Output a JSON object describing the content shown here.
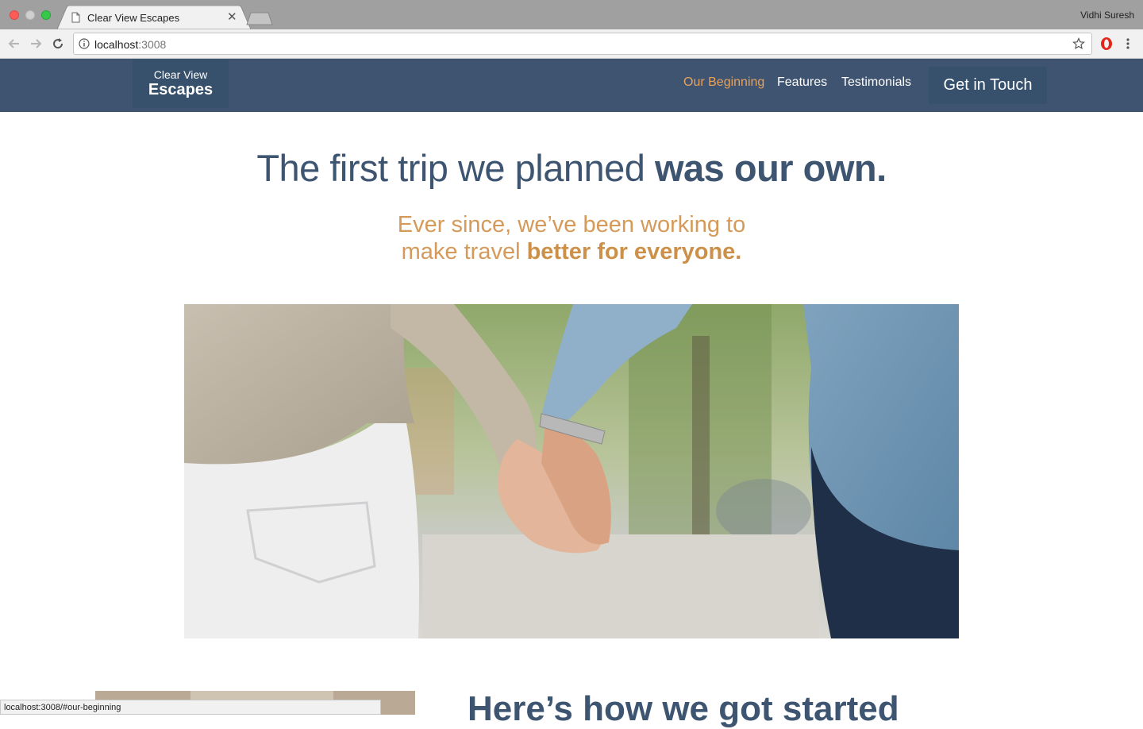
{
  "browser": {
    "tab_title": "Clear View Escapes",
    "profile_name": "Vidhi Suresh",
    "url_host": "localhost",
    "url_port": ":3008",
    "status_url": "localhost:3008/#our-beginning"
  },
  "header": {
    "logo_line1": "Clear View",
    "logo_line2": "Escapes",
    "nav": [
      {
        "label": "Our Beginning",
        "active": true
      },
      {
        "label": "Features",
        "active": false
      },
      {
        "label": "Testimonials",
        "active": false
      }
    ],
    "cta_label": "Get in Touch"
  },
  "hero": {
    "title_light": "The first trip we planned ",
    "title_bold": "was our own.",
    "sub_line1": "Ever since, we’ve been working to",
    "sub_line2_light": "make travel ",
    "sub_line2_bold": "better for everyone."
  },
  "section": {
    "title": "Here’s how we got started"
  },
  "colors": {
    "header_bg": "#3f5470",
    "accent_orange": "#e7a25e",
    "title_blue": "#3e5571",
    "sub_gold": "#d59a5a"
  }
}
